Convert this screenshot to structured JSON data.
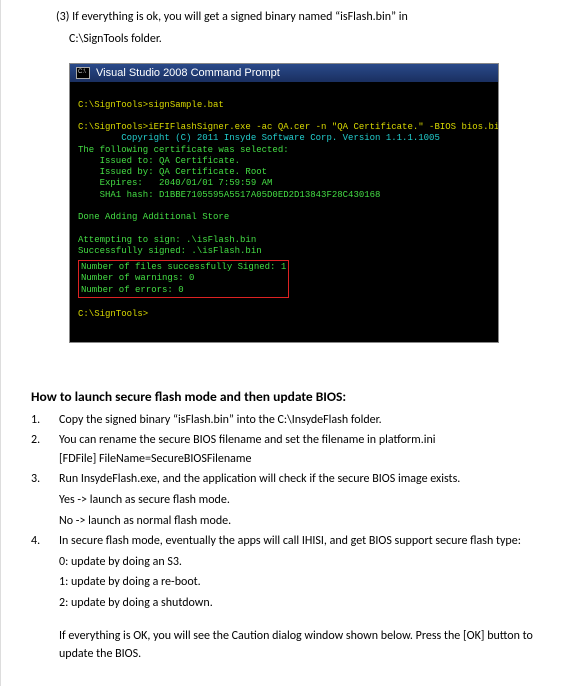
{
  "intro": {
    "line1": "(3) If everything is ok, you will get a signed binary named “isFlash.bin” in",
    "line2": "C:\\SignTools folder."
  },
  "terminal": {
    "title": "Visual Studio 2008 Command Prompt",
    "prompt1": "C:\\SignTools>signSample.bat",
    "cmd1": "C:\\SignTools>iEFIFlashSigner.exe -ac QA.cer -n \"QA Certificate.\" -BIOS bios.bin iEFIFlashSigner.exe",
    "copy": "        Copyright (C) 2011 Insyde Software Corp. Version 1.1.1.1005",
    "certh": "The following certificate was selected:",
    "cert1": "    Issued to: QA Certificate.",
    "cert2": "    Issued by: QA Certificate. Root",
    "cert3": "    Expires:   2040/01/01 7:59:59 AM",
    "cert4": "    SHA1 hash: D1BBE7105595A5517A05D0ED2D13843F28C430168",
    "done": "Done Adding Additional Store",
    "att": "Attempting to sign: .\\isFlash.bin",
    "suc": "Successfully signed: .\\isFlash.bin",
    "box1": "Number of files successfully Signed: 1",
    "box2": "Number of warnings: 0",
    "box3": "Number of errors: 0",
    "prompt2": "C:\\SignTools>"
  },
  "how": {
    "heading": "How to launch secure flash mode and then update BIOS:",
    "s1": "Copy the signed binary “isFlash.bin” into the C:\\InsydeFlash folder.",
    "s2": "You can rename the secure BIOS filename and set the filename in platform.ini",
    "s2a": "[FDFile] FileName=SecureBIOSFilename",
    "s3": "Run InsydeFlash.exe, and the application will check if the secure BIOS image exists.",
    "s3a": "Yes -> launch as secure flash mode.",
    "s3b": "No -> launch as normal flash mode.",
    "s4": "In secure flash mode, eventually the apps will call IHISI, and get BIOS support secure flash type:",
    "s4a": "0: update by doing an S3.",
    "s4b": "1: update by doing a re-boot.",
    "s4c": "2: update by doing a shutdown.",
    "tail": "If everything is OK, you will see the Caution dialog window shown below. Press the [OK] button to update the BIOS."
  }
}
